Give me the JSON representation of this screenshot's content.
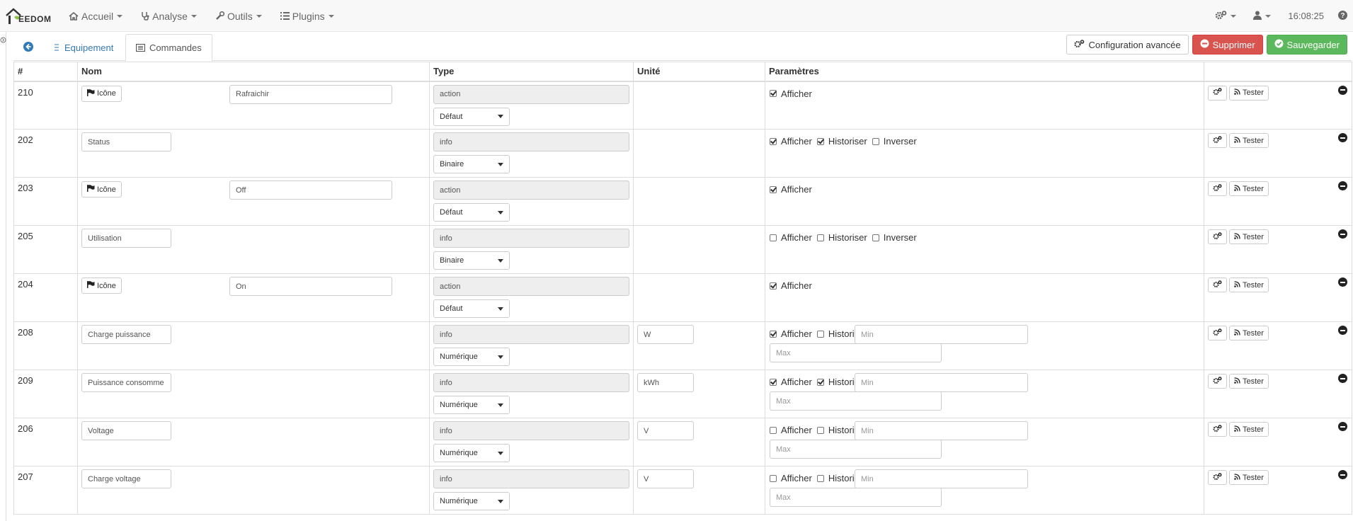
{
  "navbar": {
    "brand": "EEDOM",
    "menu": [
      {
        "label": "Accueil",
        "icon": "home-icon"
      },
      {
        "label": "Analyse",
        "icon": "stethoscope-icon"
      },
      {
        "label": "Outils",
        "icon": "wrench-icon"
      },
      {
        "label": "Plugins",
        "icon": "list-icon"
      }
    ],
    "clock": "16:08:25"
  },
  "tabs": {
    "equipement": "Equipement",
    "commandes": "Commandes"
  },
  "actions": {
    "config": "Configuration avancée",
    "delete": "Supprimer",
    "save": "Sauvegarder"
  },
  "table": {
    "headers": {
      "id": "#",
      "name": "Nom",
      "type": "Type",
      "unit": "Unité",
      "params": "Paramètres"
    },
    "icon_btn": "Icône",
    "test_btn": "Tester",
    "labels": {
      "show": "Afficher",
      "history": "Historiser",
      "invert": "Inverser"
    },
    "min_placeholder": "Min",
    "max_placeholder": "Max",
    "rows": [
      {
        "id": "210",
        "name": "Rafraichir",
        "type": "action",
        "subtype": "Défaut",
        "unit": "",
        "show": true
      },
      {
        "id": "202",
        "name": "Status",
        "type": "info",
        "subtype": "Binaire",
        "unit": "",
        "show": true,
        "history": true,
        "invert": false
      },
      {
        "id": "203",
        "name": "Off",
        "type": "action",
        "subtype": "Défaut",
        "unit": "",
        "show": true
      },
      {
        "id": "205",
        "name": "Utilisation",
        "type": "info",
        "subtype": "Binaire",
        "unit": "",
        "show": false,
        "history": false,
        "invert": false
      },
      {
        "id": "204",
        "name": "On",
        "type": "action",
        "subtype": "Défaut",
        "unit": "",
        "show": true
      },
      {
        "id": "208",
        "name": "Charge puissance",
        "type": "info",
        "subtype": "Numérique",
        "unit": "W",
        "show": true,
        "history": false
      },
      {
        "id": "209",
        "name": "Puissance consomme",
        "type": "info",
        "subtype": "Numérique",
        "unit": "kWh",
        "show": true,
        "history": true
      },
      {
        "id": "206",
        "name": "Voltage",
        "type": "info",
        "subtype": "Numérique",
        "unit": "V",
        "show": false,
        "history": false
      },
      {
        "id": "207",
        "name": "Charge voltage",
        "type": "info",
        "subtype": "Numérique",
        "unit": "V",
        "show": false,
        "history": false
      }
    ]
  },
  "colors": {
    "link": "#337ab7",
    "danger": "#d9534f",
    "success": "#5cb85c",
    "brand_leaf": "#8cc34a"
  }
}
